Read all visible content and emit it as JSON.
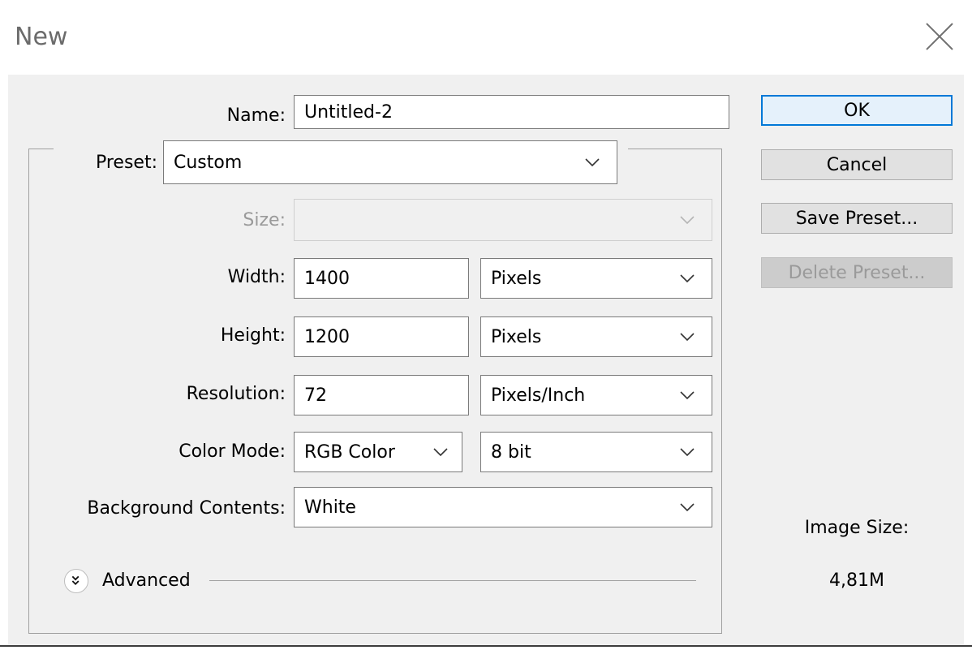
{
  "dialog": {
    "title": "New"
  },
  "name": {
    "label": "Name:",
    "value": "Untitled-2"
  },
  "preset": {
    "label": "Preset:",
    "value": "Custom"
  },
  "size": {
    "label": "Size:",
    "value": ""
  },
  "width": {
    "label": "Width:",
    "value": "1400",
    "unit": "Pixels"
  },
  "height": {
    "label": "Height:",
    "value": "1200",
    "unit": "Pixels"
  },
  "resolution": {
    "label": "Resolution:",
    "value": "72",
    "unit": "Pixels/Inch"
  },
  "color_mode": {
    "label": "Color Mode:",
    "mode": "RGB Color",
    "depth": "8 bit"
  },
  "background": {
    "label": "Background Contents:",
    "value": "White"
  },
  "advanced": {
    "label": "Advanced"
  },
  "buttons": {
    "ok": "OK",
    "cancel": "Cancel",
    "save_preset": "Save Preset...",
    "delete_preset": "Delete Preset..."
  },
  "image_size": {
    "label": "Image Size:",
    "value": "4,81M"
  },
  "colors": {
    "accent": "#0078d7",
    "dialog_bg": "#f0f0f0",
    "disabled_text": "#9a9a9a"
  },
  "icons": [
    "close-icon",
    "chevron-down-icon",
    "double-chevron-down-icon"
  ]
}
